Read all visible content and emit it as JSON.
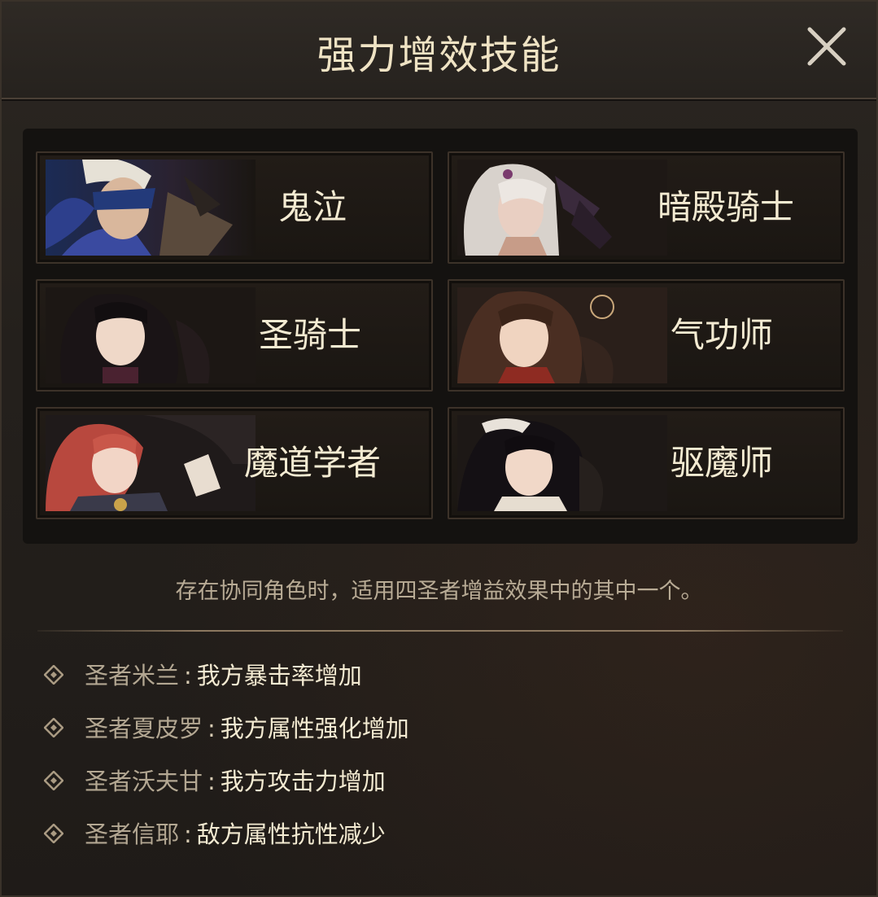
{
  "dialog": {
    "title": "强力增效技能",
    "close_icon": "close-icon"
  },
  "characters": [
    {
      "name": "鬼泣",
      "portrait": "masked-swordsman-portrait"
    },
    {
      "name": "暗殿骑士",
      "portrait": "white-haired-knight-portrait"
    },
    {
      "name": "圣骑士",
      "portrait": "dark-haired-crusader-portrait"
    },
    {
      "name": "气功师",
      "portrait": "brown-haired-nen-master-portrait"
    },
    {
      "name": "魔道学者",
      "portrait": "red-haired-mage-portrait"
    },
    {
      "name": "驱魔师",
      "portrait": "black-haired-exorcist-portrait"
    }
  ],
  "description": "存在协同角色时，适用四圣者增益效果中的其中一个。",
  "buffs": [
    {
      "name": "圣者米兰",
      "sep": ":",
      "effect": "我方暴击率增加"
    },
    {
      "name": "圣者夏皮罗",
      "sep": ":",
      "effect": "我方属性强化增加"
    },
    {
      "name": "圣者沃夫甘",
      "sep": ":",
      "effect": "我方攻击力增加"
    },
    {
      "name": "圣者信耶",
      "sep": ":",
      "effect": "敌方属性抗性减少"
    }
  ],
  "colors": {
    "title": "#efe3c4",
    "name_text": "#f4ebd2",
    "muted_text": "#b3a792",
    "panel_border": "#3c3229"
  }
}
